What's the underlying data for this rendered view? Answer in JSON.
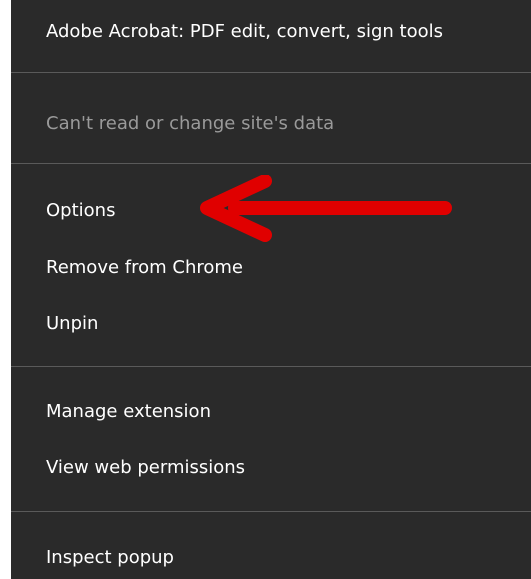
{
  "menu": {
    "header_title": "Adobe Acrobat: PDF edit, convert, sign tools",
    "site_access_label": "Can't read or change site's data",
    "items": [
      {
        "label": "Options"
      },
      {
        "label": "Remove from Chrome"
      },
      {
        "label": "Unpin"
      },
      {
        "label": "Manage extension"
      },
      {
        "label": "View web permissions"
      },
      {
        "label": "Inspect popup"
      }
    ]
  },
  "annotation": {
    "arrow_icon": "red-arrow-icon",
    "arrow_color": "#e00000",
    "points_to": "Options"
  },
  "colors": {
    "menu_background": "#2a2a2a",
    "text": "#ffffff",
    "disabled_text": "#9a9a9a",
    "separator": "#5a5a5a"
  }
}
